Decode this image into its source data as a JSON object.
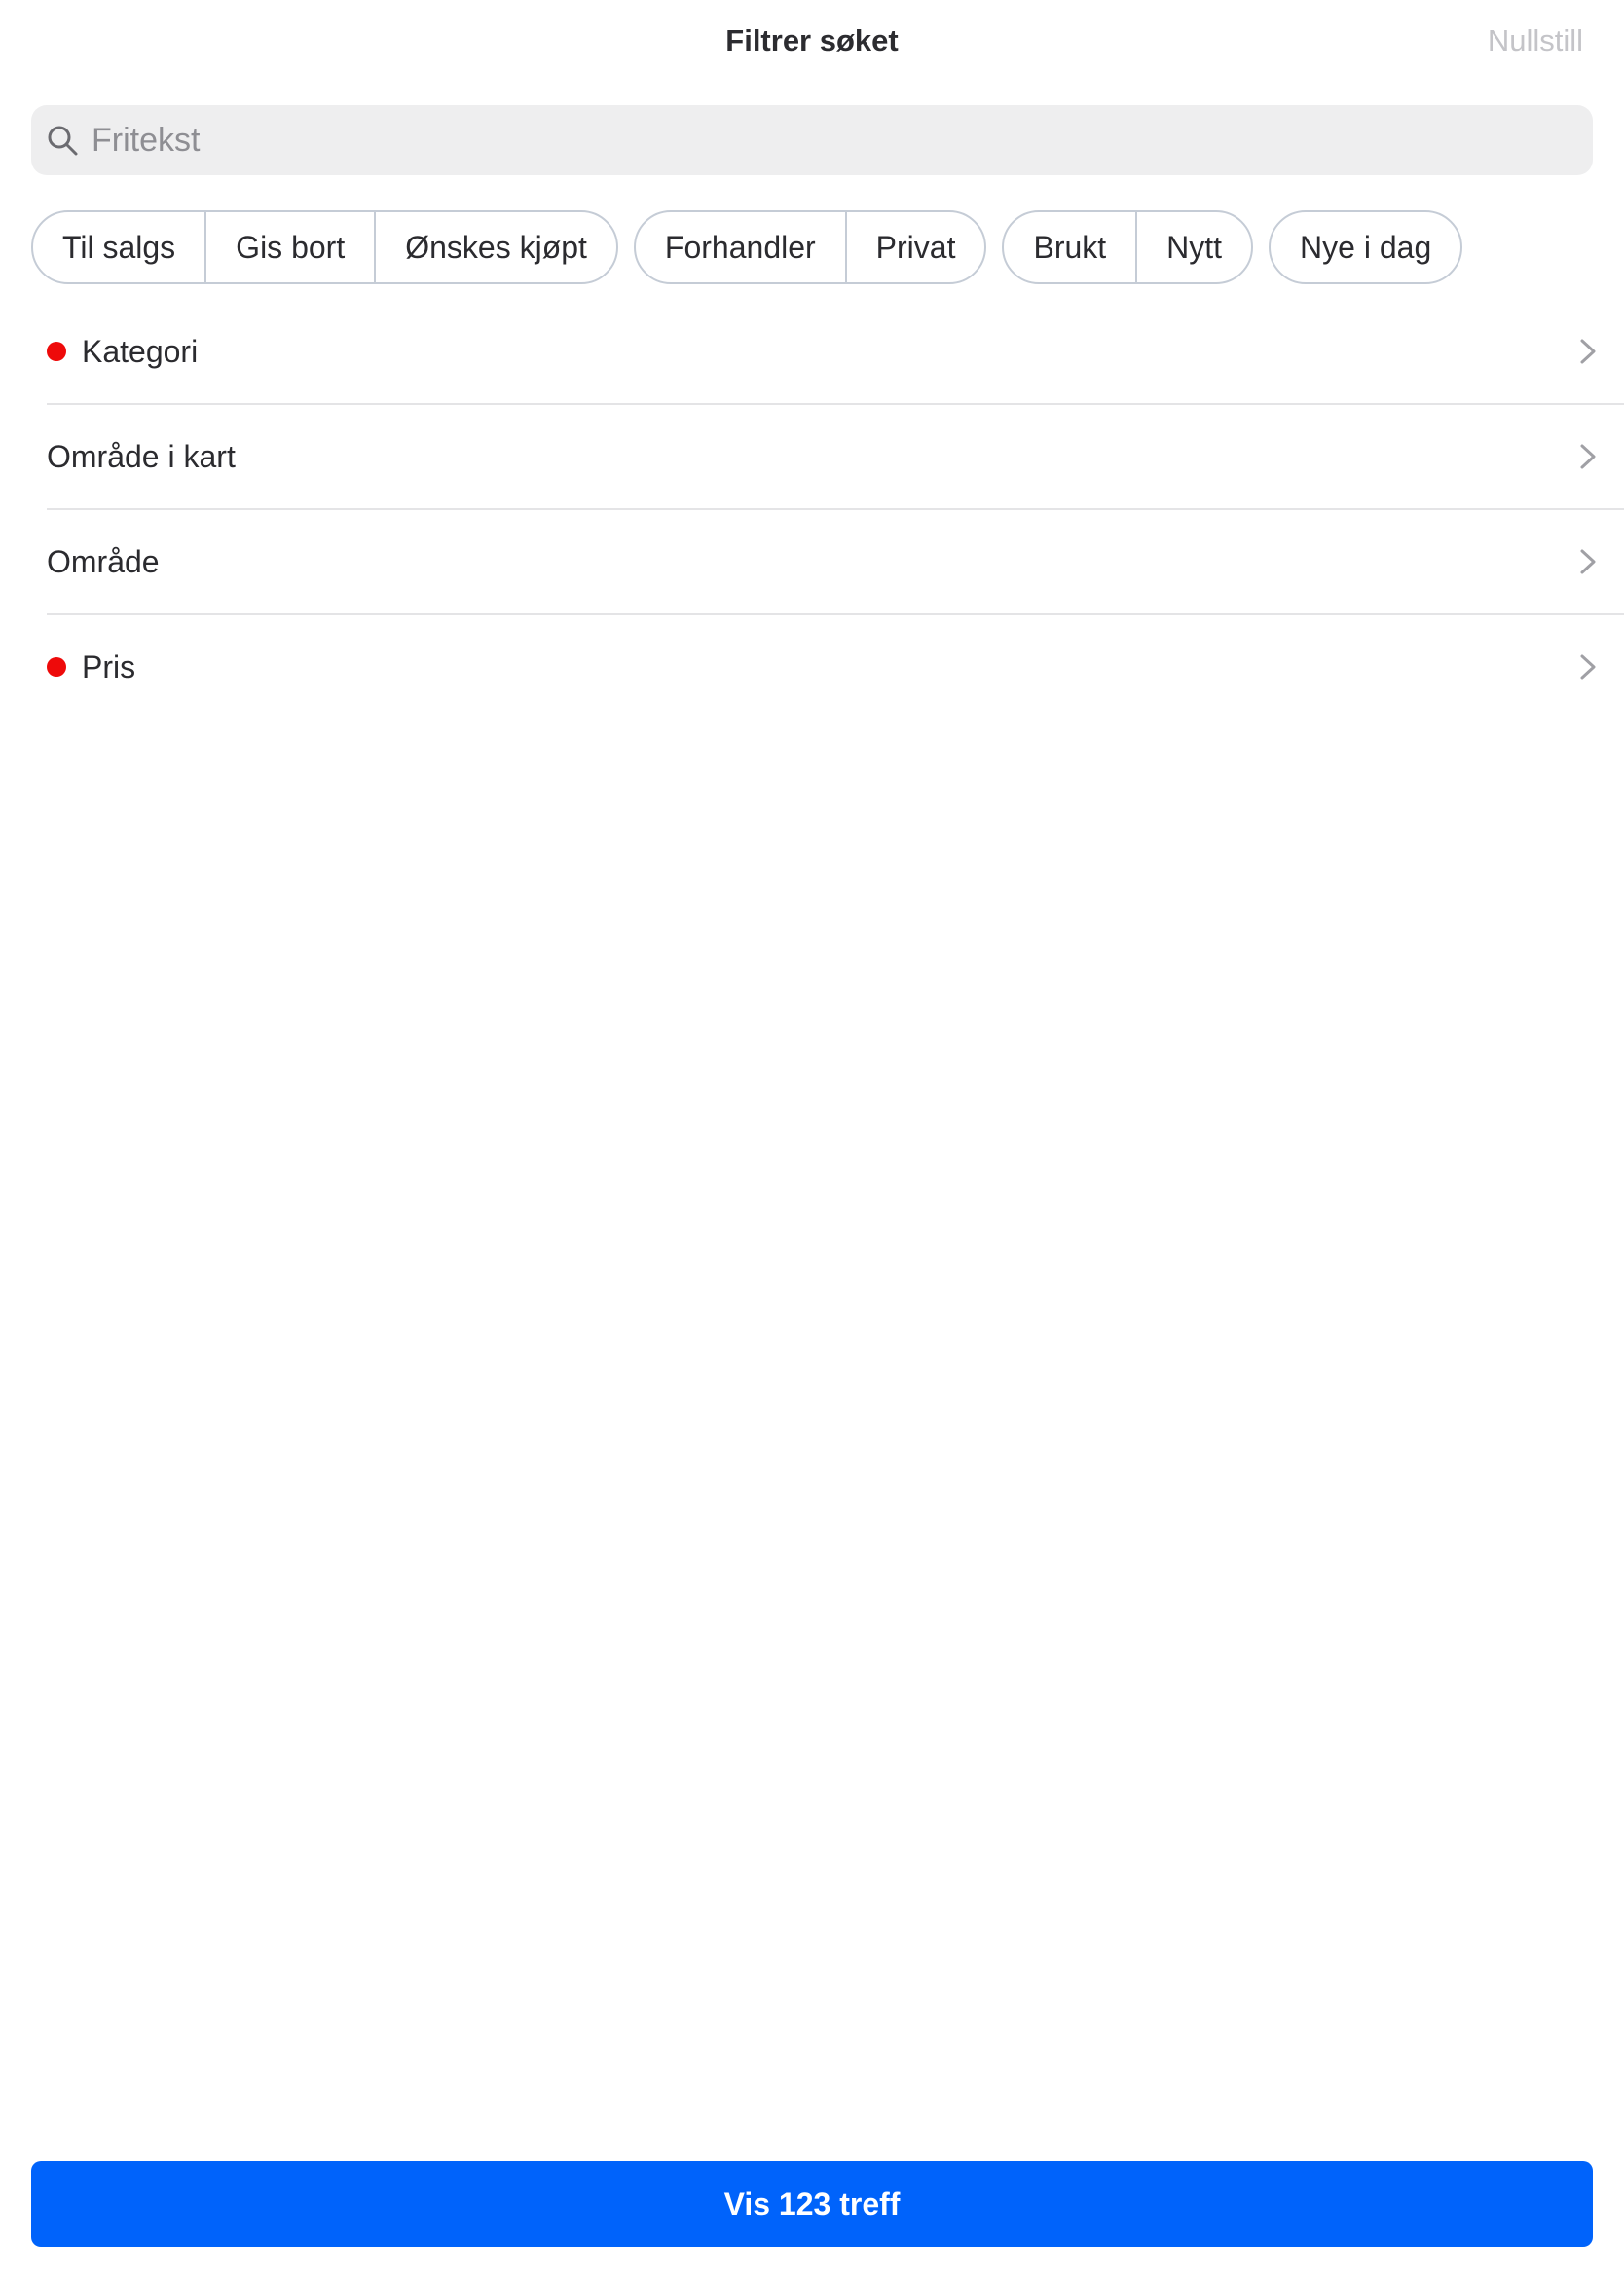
{
  "header": {
    "title": "Filtrer søket",
    "reset_label": "Nullstill"
  },
  "search": {
    "placeholder": "Fritekst",
    "value": ""
  },
  "chip_groups": [
    [
      "Til salgs",
      "Gis bort",
      "Ønskes kjøpt"
    ],
    [
      "Forhandler",
      "Privat"
    ],
    [
      "Brukt",
      "Nytt"
    ],
    [
      "Nye i dag"
    ]
  ],
  "filters": [
    {
      "label": "Kategori",
      "active": true
    },
    {
      "label": "Område i kart",
      "active": false
    },
    {
      "label": "Område",
      "active": false
    },
    {
      "label": "Pris",
      "active": true
    }
  ],
  "footer": {
    "button_label": "Vis 123 treff"
  },
  "colors": {
    "primary": "#0063fb",
    "active_dot": "#ee0a0a",
    "chip_border": "#c5ccd6",
    "muted": "#c4c4c8"
  },
  "icons": {
    "search": "search-icon",
    "row_arrow": "chevron-right-icon"
  }
}
